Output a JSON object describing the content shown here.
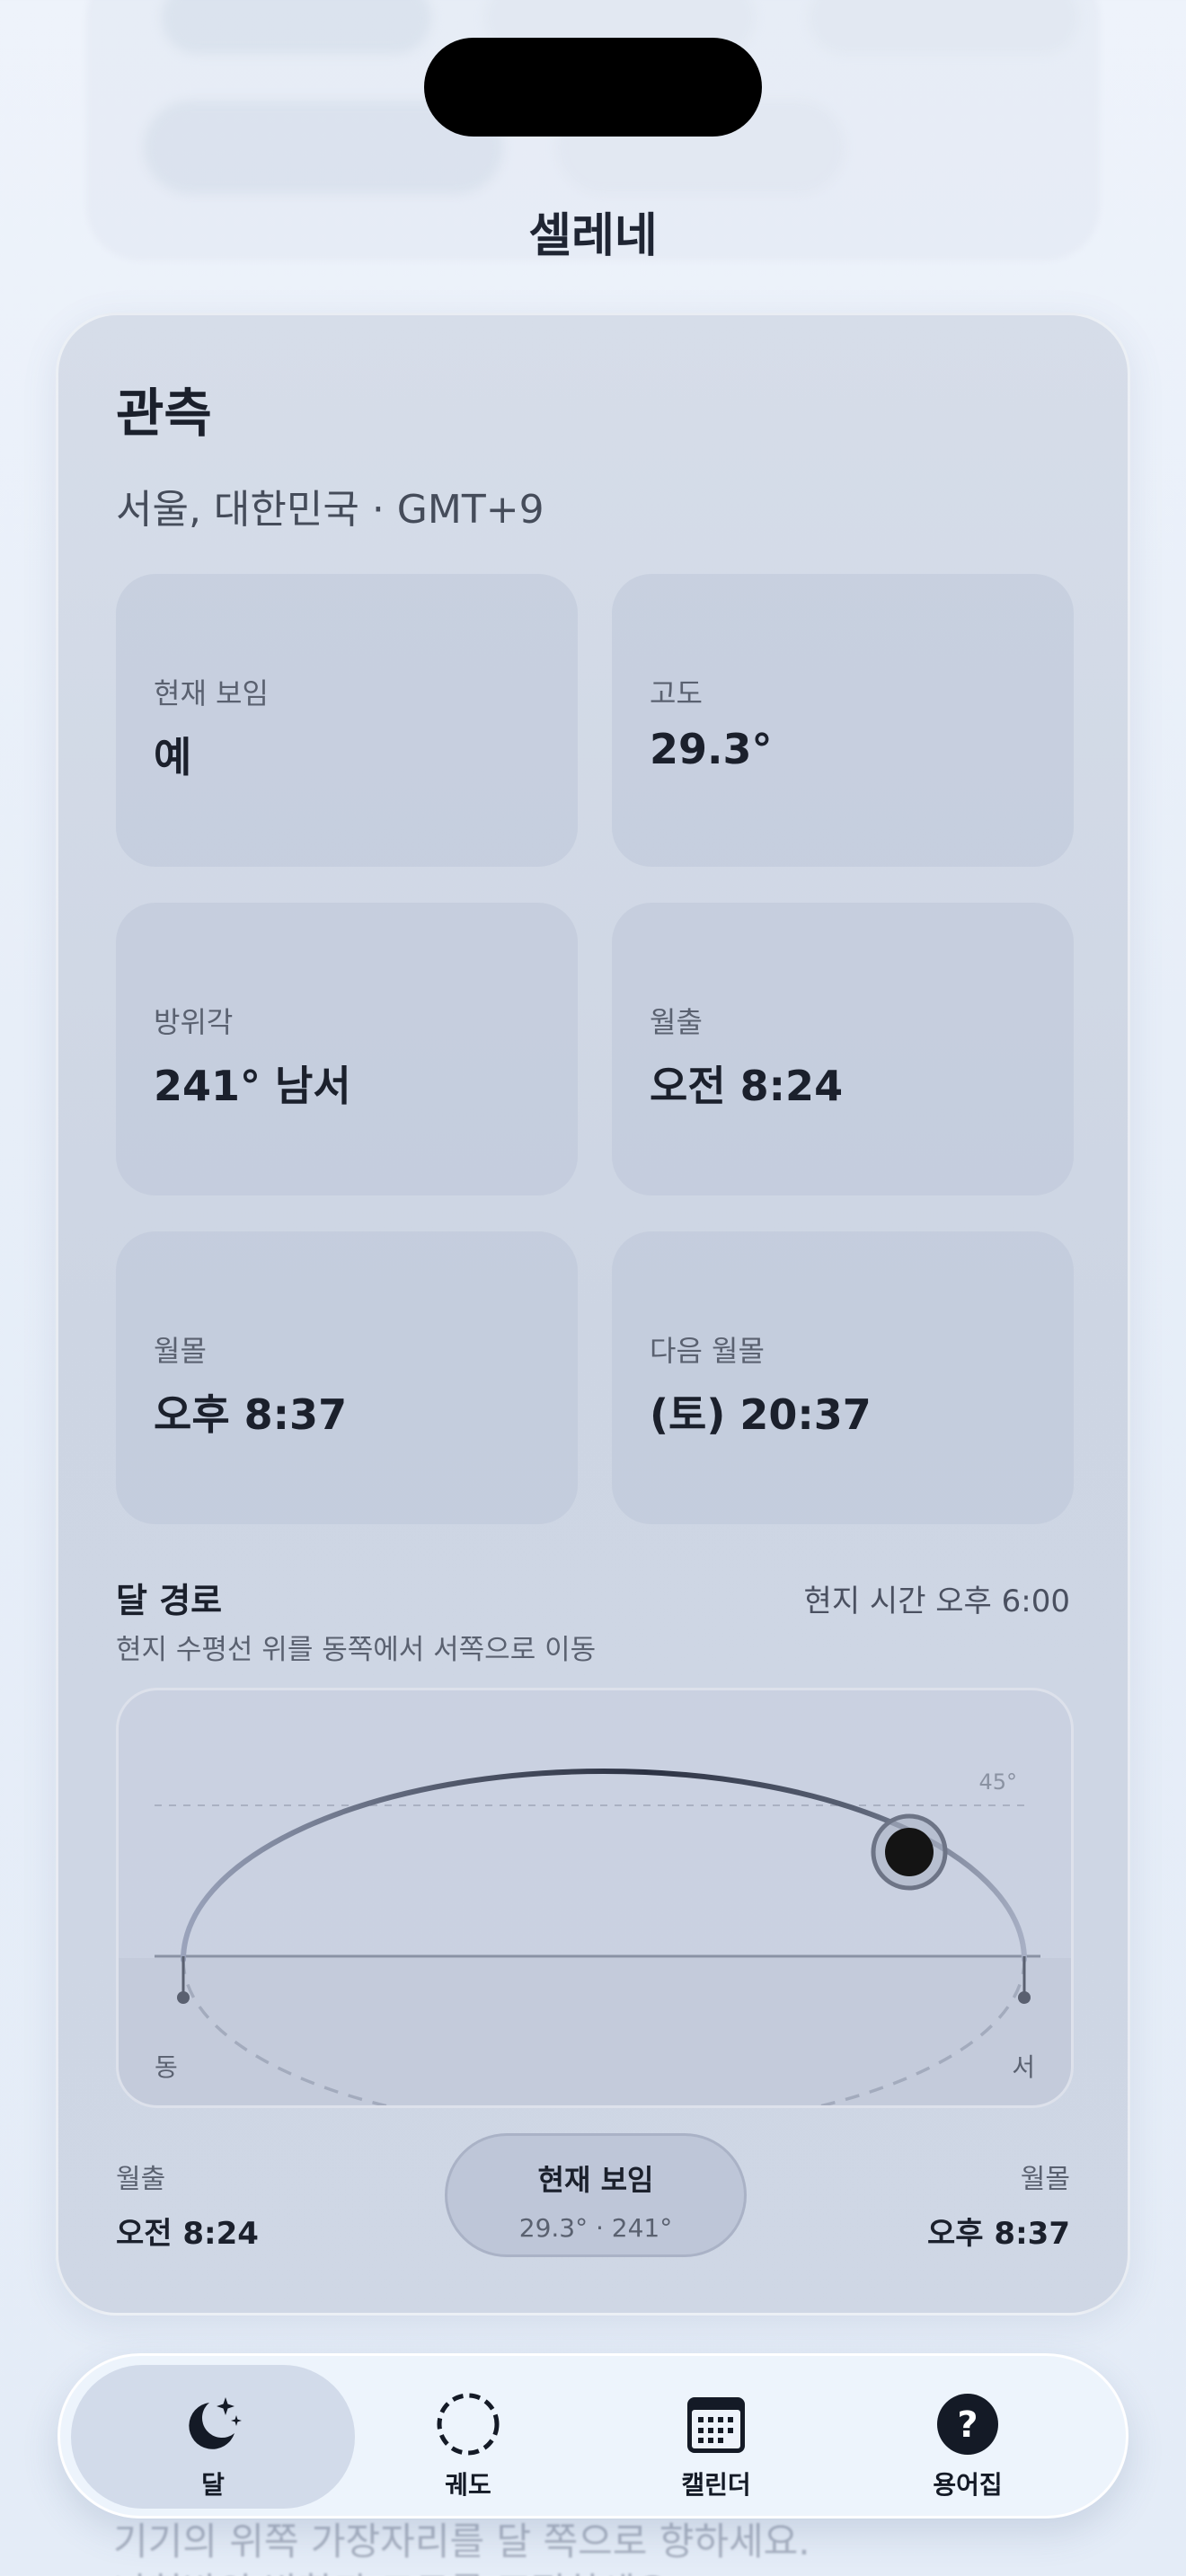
{
  "app": {
    "title": "셀레네"
  },
  "observation": {
    "title": "관측",
    "location": "서울, 대한민국 · GMT+9",
    "tiles": [
      {
        "label": "현재 보임",
        "value": "예"
      },
      {
        "label": "고도",
        "value": "29.3°"
      },
      {
        "label": "방위각",
        "value": "241° 남서"
      },
      {
        "label": "월출",
        "value": "오전 8:24"
      },
      {
        "label": "월몰",
        "value": "오후 8:37"
      },
      {
        "label": "다음 월몰",
        "value": "(토) 20:37"
      }
    ]
  },
  "moon_path": {
    "title": "달 경로",
    "local_time": "현지 시간 오후 6:00",
    "subtitle": "현지 수평선 위를 동쪽에서 서쪽으로 이동",
    "label_east": "동",
    "label_west": "서",
    "label_45": "45°",
    "rise_label": "월출",
    "rise_value": "오전 8:24",
    "set_label": "월몰",
    "set_value": "오후 8:37",
    "current": {
      "title": "현재 보임",
      "detail": "29.3° · 241°"
    }
  },
  "background_hint": {
    "line1": "기기의 위쪽 가장자리를 달 쪽으로 향하세요.",
    "line2": "나침반의 방향과 고도를 조정하세요."
  },
  "tabs": [
    {
      "label": "달",
      "icon": "moon-stars-icon",
      "active": true
    },
    {
      "label": "궤도",
      "icon": "orbit-dashed-circle-icon",
      "active": false
    },
    {
      "label": "캘린더",
      "icon": "calendar-icon",
      "active": false
    },
    {
      "label": "용어집",
      "icon": "question-circle-icon",
      "active": false
    }
  ],
  "colors": {
    "accent": "#1b2434",
    "panel": "#d2d9e6",
    "moon": "#141414"
  }
}
